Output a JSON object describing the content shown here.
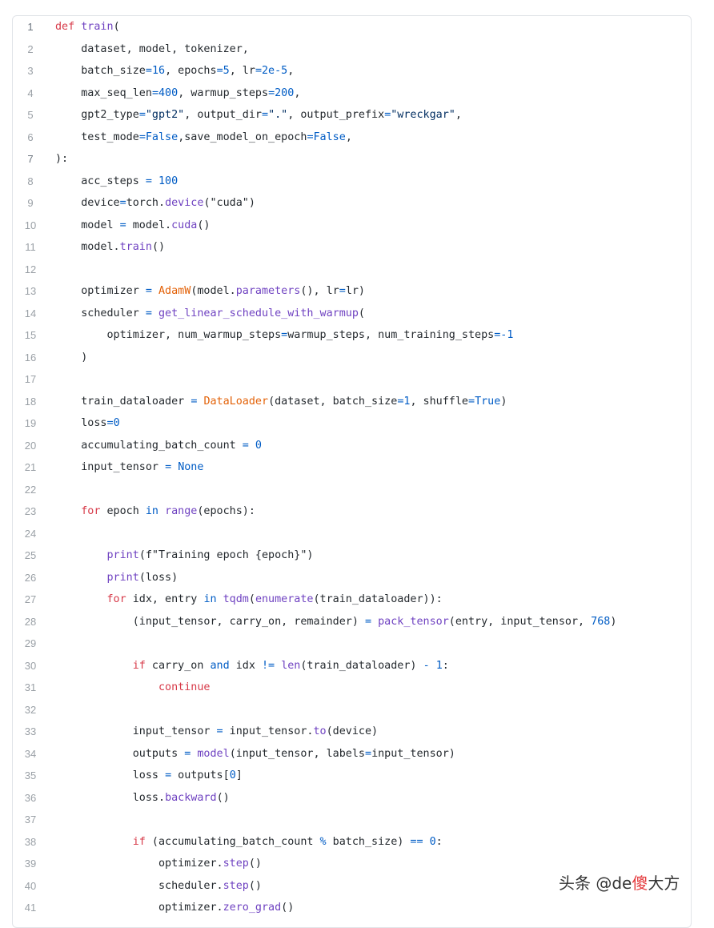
{
  "code": {
    "lines": [
      {
        "n": "1",
        "t": [
          [
            "kw",
            "def"
          ],
          [
            "p",
            " "
          ],
          [
            "fn",
            "train"
          ],
          [
            "p",
            "("
          ]
        ]
      },
      {
        "n": "2",
        "t": [
          [
            "p",
            "    dataset, model, tokenizer,"
          ]
        ]
      },
      {
        "n": "3",
        "t": [
          [
            "p",
            "    batch_size"
          ],
          [
            "op",
            "="
          ],
          [
            "num",
            "16"
          ],
          [
            "p",
            ", epochs"
          ],
          [
            "op",
            "="
          ],
          [
            "num",
            "5"
          ],
          [
            "p",
            ", lr"
          ],
          [
            "op",
            "="
          ],
          [
            "num",
            "2e-5"
          ],
          [
            "p",
            ","
          ]
        ]
      },
      {
        "n": "4",
        "t": [
          [
            "p",
            "    max_seq_len"
          ],
          [
            "op",
            "="
          ],
          [
            "num",
            "400"
          ],
          [
            "p",
            ", warmup_steps"
          ],
          [
            "op",
            "="
          ],
          [
            "num",
            "200"
          ],
          [
            "p",
            ","
          ]
        ]
      },
      {
        "n": "5",
        "t": [
          [
            "p",
            "    gpt2_type"
          ],
          [
            "op",
            "="
          ],
          [
            "str",
            "\"gpt2\""
          ],
          [
            "p",
            ", output_dir"
          ],
          [
            "op",
            "="
          ],
          [
            "str",
            "\".\""
          ],
          [
            "p",
            ", output_prefix"
          ],
          [
            "op",
            "="
          ],
          [
            "str",
            "\"wreckgar\""
          ],
          [
            "p",
            ","
          ]
        ]
      },
      {
        "n": "6",
        "t": [
          [
            "p",
            "    test_mode"
          ],
          [
            "op",
            "="
          ],
          [
            "num",
            "False"
          ],
          [
            "p",
            ",save_model_on_epoch"
          ],
          [
            "op",
            "="
          ],
          [
            "num",
            "False"
          ],
          [
            "p",
            ","
          ]
        ]
      },
      {
        "n": "7",
        "t": [
          [
            "p",
            "):"
          ]
        ]
      },
      {
        "n": "8",
        "t": [
          [
            "p",
            "    acc_steps "
          ],
          [
            "op",
            "="
          ],
          [
            "p",
            " "
          ],
          [
            "num",
            "100"
          ]
        ]
      },
      {
        "n": "9",
        "t": [
          [
            "p",
            "    device"
          ],
          [
            "op",
            "="
          ],
          [
            "p",
            "torch."
          ],
          [
            "fn",
            "device"
          ],
          [
            "p",
            "(\"cuda\")"
          ]
        ]
      },
      {
        "n": "10",
        "t": [
          [
            "p",
            "    model "
          ],
          [
            "op",
            "="
          ],
          [
            "p",
            " model."
          ],
          [
            "fn",
            "cuda"
          ],
          [
            "p",
            "()"
          ]
        ]
      },
      {
        "n": "11",
        "t": [
          [
            "p",
            "    model."
          ],
          [
            "fn",
            "train"
          ],
          [
            "p",
            "()"
          ]
        ]
      },
      {
        "n": "12",
        "t": []
      },
      {
        "n": "13",
        "t": [
          [
            "p",
            "    optimizer "
          ],
          [
            "op",
            "="
          ],
          [
            "p",
            " "
          ],
          [
            "cls",
            "AdamW"
          ],
          [
            "p",
            "(model."
          ],
          [
            "fn",
            "parameters"
          ],
          [
            "p",
            "(), lr"
          ],
          [
            "op",
            "="
          ],
          [
            "p",
            "lr)"
          ]
        ]
      },
      {
        "n": "14",
        "t": [
          [
            "p",
            "    scheduler "
          ],
          [
            "op",
            "="
          ],
          [
            "p",
            " "
          ],
          [
            "fn",
            "get_linear_schedule_with_warmup"
          ],
          [
            "p",
            "("
          ]
        ]
      },
      {
        "n": "15",
        "t": [
          [
            "p",
            "        optimizer, num_warmup_steps"
          ],
          [
            "op",
            "="
          ],
          [
            "p",
            "warmup_steps, num_training_steps"
          ],
          [
            "op",
            "="
          ],
          [
            "num",
            "-1"
          ]
        ]
      },
      {
        "n": "16",
        "t": [
          [
            "p",
            "    )"
          ]
        ]
      },
      {
        "n": "17",
        "t": []
      },
      {
        "n": "18",
        "t": [
          [
            "p",
            "    train_dataloader "
          ],
          [
            "op",
            "="
          ],
          [
            "p",
            " "
          ],
          [
            "cls",
            "DataLoader"
          ],
          [
            "p",
            "(dataset, batch_size"
          ],
          [
            "op",
            "="
          ],
          [
            "num",
            "1"
          ],
          [
            "p",
            ", shuffle"
          ],
          [
            "op",
            "="
          ],
          [
            "num",
            "True"
          ],
          [
            "p",
            ")"
          ]
        ]
      },
      {
        "n": "19",
        "t": [
          [
            "p",
            "    loss"
          ],
          [
            "op",
            "="
          ],
          [
            "num",
            "0"
          ]
        ]
      },
      {
        "n": "20",
        "t": [
          [
            "p",
            "    accumulating_batch_count "
          ],
          [
            "op",
            "="
          ],
          [
            "p",
            " "
          ],
          [
            "num",
            "0"
          ]
        ]
      },
      {
        "n": "21",
        "t": [
          [
            "p",
            "    input_tensor "
          ],
          [
            "op",
            "="
          ],
          [
            "p",
            " "
          ],
          [
            "num",
            "None"
          ]
        ]
      },
      {
        "n": "22",
        "t": []
      },
      {
        "n": "23",
        "t": [
          [
            "p",
            "    "
          ],
          [
            "kw",
            "for"
          ],
          [
            "p",
            " epoch "
          ],
          [
            "op",
            "in"
          ],
          [
            "p",
            " "
          ],
          [
            "bi",
            "range"
          ],
          [
            "p",
            "(epochs):"
          ]
        ]
      },
      {
        "n": "24",
        "t": []
      },
      {
        "n": "25",
        "t": [
          [
            "p",
            "        "
          ],
          [
            "bi",
            "print"
          ],
          [
            "p",
            "(f\"Training epoch {epoch}\")"
          ]
        ]
      },
      {
        "n": "26",
        "t": [
          [
            "p",
            "        "
          ],
          [
            "bi",
            "print"
          ],
          [
            "p",
            "(loss)"
          ]
        ]
      },
      {
        "n": "27",
        "t": [
          [
            "p",
            "        "
          ],
          [
            "kw",
            "for"
          ],
          [
            "p",
            " idx, entry "
          ],
          [
            "op",
            "in"
          ],
          [
            "p",
            " "
          ],
          [
            "fn",
            "tqdm"
          ],
          [
            "p",
            "("
          ],
          [
            "bi",
            "enumerate"
          ],
          [
            "p",
            "(train_dataloader)):"
          ]
        ]
      },
      {
        "n": "28",
        "t": [
          [
            "p",
            "            (input_tensor, carry_on, remainder) "
          ],
          [
            "op",
            "="
          ],
          [
            "p",
            " "
          ],
          [
            "fn",
            "pack_tensor"
          ],
          [
            "p",
            "(entry, input_tensor, "
          ],
          [
            "num",
            "768"
          ],
          [
            "p",
            ")"
          ]
        ]
      },
      {
        "n": "29",
        "t": []
      },
      {
        "n": "30",
        "t": [
          [
            "p",
            "            "
          ],
          [
            "kw",
            "if"
          ],
          [
            "p",
            " carry_on "
          ],
          [
            "op",
            "and"
          ],
          [
            "p",
            " idx "
          ],
          [
            "op",
            "!="
          ],
          [
            "p",
            " "
          ],
          [
            "bi",
            "len"
          ],
          [
            "p",
            "(train_dataloader) "
          ],
          [
            "op",
            "-"
          ],
          [
            "p",
            " "
          ],
          [
            "num",
            "1"
          ],
          [
            "p",
            ":"
          ]
        ]
      },
      {
        "n": "31",
        "t": [
          [
            "p",
            "                "
          ],
          [
            "kw",
            "continue"
          ]
        ]
      },
      {
        "n": "32",
        "t": []
      },
      {
        "n": "33",
        "t": [
          [
            "p",
            "            input_tensor "
          ],
          [
            "op",
            "="
          ],
          [
            "p",
            " input_tensor."
          ],
          [
            "fn",
            "to"
          ],
          [
            "p",
            "(device)"
          ]
        ]
      },
      {
        "n": "34",
        "t": [
          [
            "p",
            "            outputs "
          ],
          [
            "op",
            "="
          ],
          [
            "p",
            " "
          ],
          [
            "fn",
            "model"
          ],
          [
            "p",
            "(input_tensor, labels"
          ],
          [
            "op",
            "="
          ],
          [
            "p",
            "input_tensor)"
          ]
        ]
      },
      {
        "n": "35",
        "t": [
          [
            "p",
            "            loss "
          ],
          [
            "op",
            "="
          ],
          [
            "p",
            " outputs["
          ],
          [
            "num",
            "0"
          ],
          [
            "p",
            "]"
          ]
        ]
      },
      {
        "n": "36",
        "t": [
          [
            "p",
            "            loss."
          ],
          [
            "fn",
            "backward"
          ],
          [
            "p",
            "()"
          ]
        ]
      },
      {
        "n": "37",
        "t": []
      },
      {
        "n": "38",
        "t": [
          [
            "p",
            "            "
          ],
          [
            "kw",
            "if"
          ],
          [
            "p",
            " (accumulating_batch_count "
          ],
          [
            "op",
            "%"
          ],
          [
            "p",
            " batch_size) "
          ],
          [
            "op",
            "=="
          ],
          [
            "p",
            " "
          ],
          [
            "num",
            "0"
          ],
          [
            "p",
            ":"
          ]
        ]
      },
      {
        "n": "39",
        "t": [
          [
            "p",
            "                optimizer."
          ],
          [
            "fn",
            "step"
          ],
          [
            "p",
            "()"
          ]
        ]
      },
      {
        "n": "40",
        "t": [
          [
            "p",
            "                scheduler."
          ],
          [
            "fn",
            "step"
          ],
          [
            "p",
            "()"
          ]
        ]
      },
      {
        "n": "41",
        "t": [
          [
            "p",
            "                optimizer."
          ],
          [
            "fn",
            "zero_grad"
          ],
          [
            "p",
            "()"
          ]
        ]
      }
    ]
  },
  "watermark": {
    "prefix": "头条 @de",
    "accent": "傻",
    "suffix": "大方"
  }
}
